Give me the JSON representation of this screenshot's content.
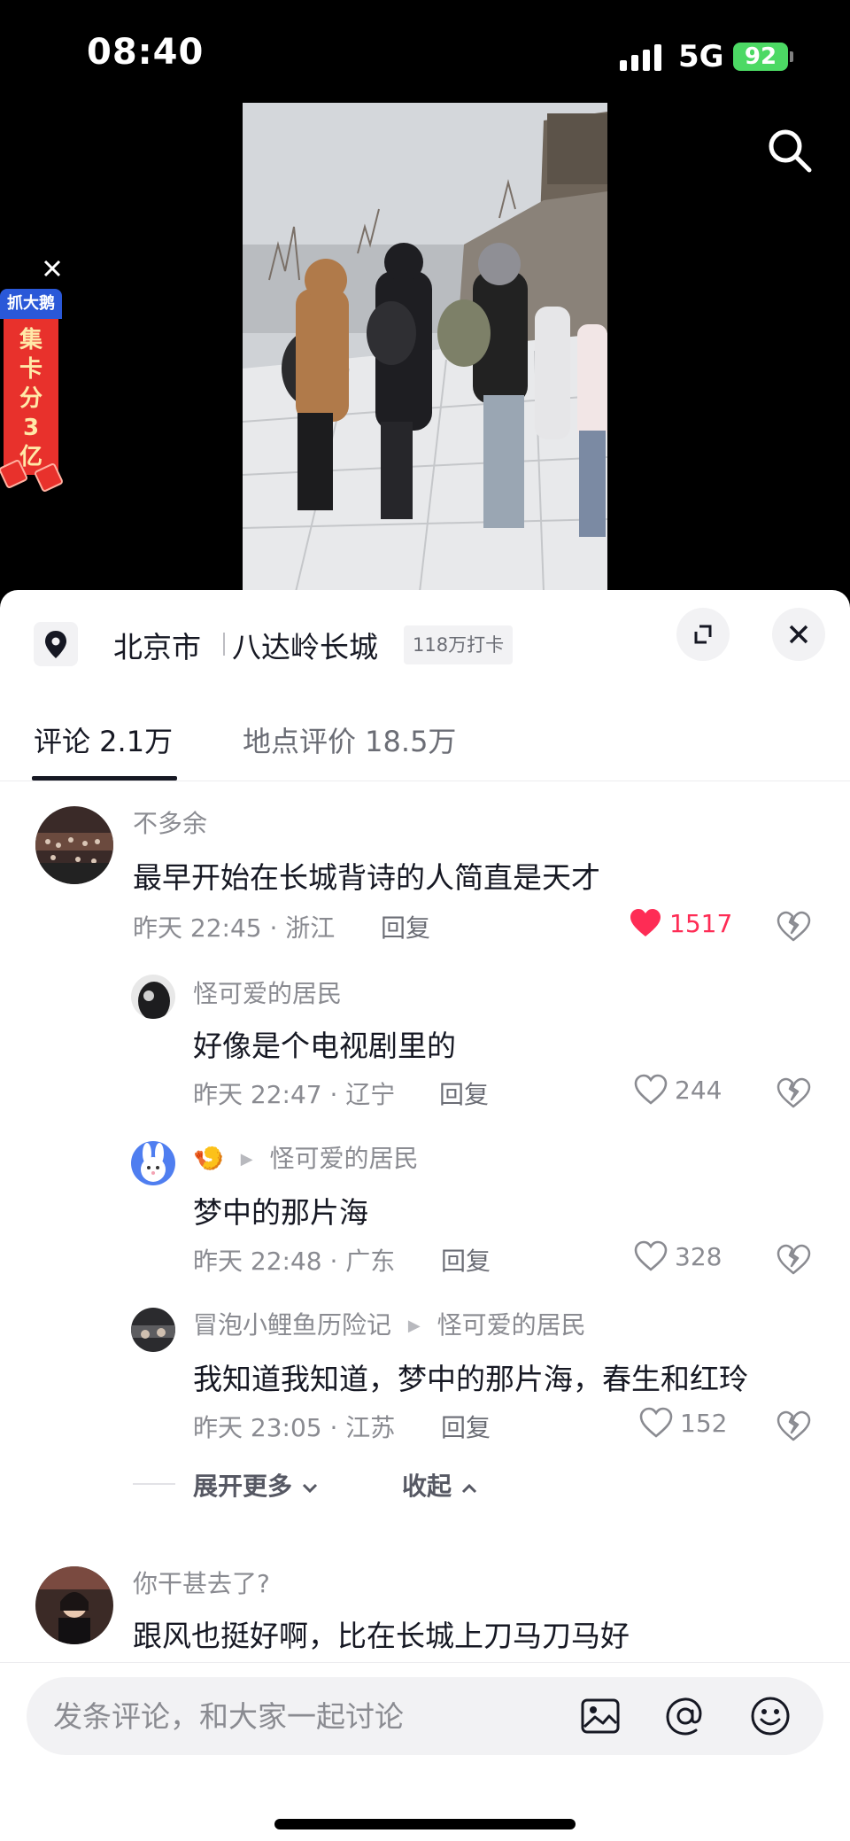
{
  "status_bar": {
    "time": "08:40",
    "network": "5G",
    "battery": "92"
  },
  "promo": {
    "brand": "抓大鹅",
    "lines": [
      "集",
      "卡",
      "分",
      "3",
      "亿"
    ]
  },
  "location": {
    "city": "北京市",
    "place": "八达岭长城",
    "checkins": "118万打卡"
  },
  "tabs": [
    {
      "label": "评论 2.1万",
      "active": true
    },
    {
      "label": "地点评价 18.5万",
      "active": false
    }
  ],
  "comments": [
    {
      "author": "不多余",
      "text": "最早开始在长城背诗的人简直是天才",
      "meta": "昨天 22:45 · 浙江",
      "reply": "回复",
      "likes": "1517",
      "liked": true
    },
    {
      "author": "怪可爱的居民",
      "text": "好像是个电视剧里的",
      "meta": "昨天 22:47 · 辽宁",
      "reply": "回复",
      "likes": "244"
    },
    {
      "author": "🍤",
      "reply_to": "怪可爱的居民",
      "text": "梦中的那片海",
      "meta": "昨天 22:48 · 广东",
      "reply": "回复",
      "likes": "328"
    },
    {
      "author": "冒泡小鲤鱼历险记",
      "reply_to": "怪可爱的居民",
      "text": "我知道我知道，梦中的那片海，春生和红玲",
      "meta": "昨天 23:05 · 江苏",
      "reply": "回复",
      "likes": "152"
    },
    {
      "author": "你干甚去了?",
      "text": "跟风也挺好啊，比在长城上刀马刀马好"
    }
  ],
  "expand": {
    "more": "展开更多",
    "collapse": "收起"
  },
  "input": {
    "placeholder": "发条评论，和大家一起讨论"
  },
  "icons": [
    "search-icon",
    "close-icon",
    "location-pin-icon",
    "expand-icon",
    "heart-icon",
    "broken-heart-icon",
    "image-icon",
    "at-icon",
    "emoji-icon"
  ],
  "colors": {
    "like_red": "#fe2c55",
    "muted": "#8a8b91",
    "text": "#161823"
  }
}
